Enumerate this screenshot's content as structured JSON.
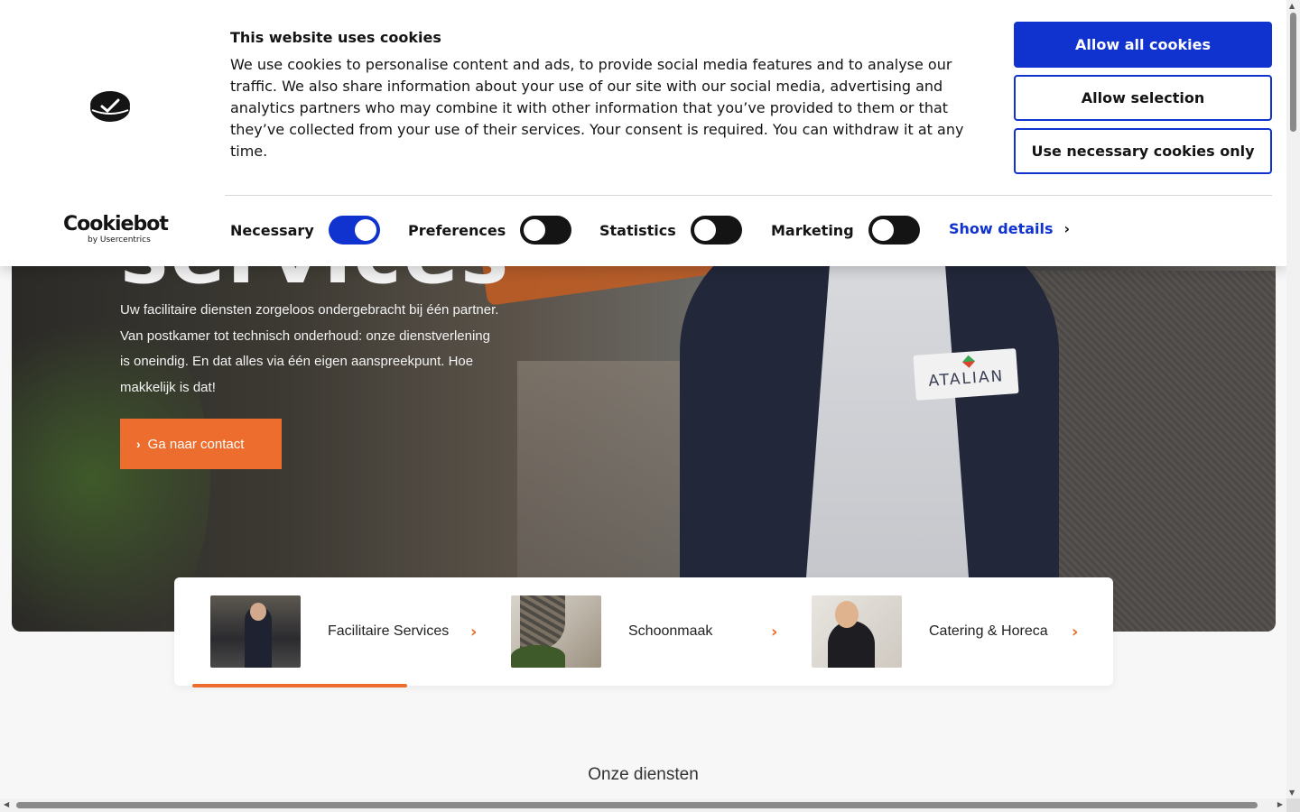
{
  "cookie_banner": {
    "title": "This website uses cookies",
    "text": "We use cookies to personalise content and ads, to provide social media features and to analyse our traffic. We also share information about your use of our site with our social media, advertising and analytics partners who may combine it with other information that you’ve provided to them or that they’ve collected from your use of their services. Your consent is required. You can withdraw it at any time.",
    "buttons": {
      "allow_all": "Allow all cookies",
      "allow_selection": "Allow selection",
      "necessary_only": "Use necessary cookies only"
    },
    "toggles": [
      {
        "label": "Necessary",
        "enabled": true
      },
      {
        "label": "Preferences",
        "enabled": false
      },
      {
        "label": "Statistics",
        "enabled": false
      },
      {
        "label": "Marketing",
        "enabled": false
      }
    ],
    "show_details": "Show details",
    "brand": {
      "name": "Cookiebot",
      "sub": "by Usercentrics"
    },
    "accent_color": "#1032cf"
  },
  "hero": {
    "title_fragment": "services",
    "subtitle": "Uw facilitaire diensten zorgeloos ondergebracht bij één partner. Van postkamer tot technisch onderhoud: onze dienstverlening is oneindig. En dat alles via één eigen aanspreekpunt. Hoe makkelijk is dat!",
    "cta": "Ga naar contact",
    "badge_text": "ATALIAN",
    "accent_color": "#ec6d2d"
  },
  "service_tabs": [
    {
      "label": "Facilitaire Services",
      "active": true
    },
    {
      "label": "Schoonmaak",
      "active": false
    },
    {
      "label": "Catering & Horeca",
      "active": false
    }
  ],
  "section": {
    "heading": "Onze diensten"
  },
  "icons": {
    "chevron": "chevron-right-icon",
    "cookie_logo": "cookiebot-logo-icon"
  }
}
